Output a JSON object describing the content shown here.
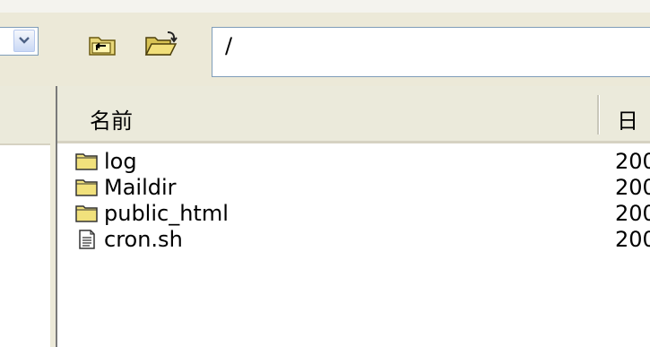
{
  "left_panel": {
    "dropdown_icon": "chevron-down-icon"
  },
  "toolbar": {
    "up_icon": "folder-up-icon",
    "open_icon": "open-folder-icon",
    "path_value": "/"
  },
  "file_list": {
    "columns": {
      "name": "名前",
      "date": "日"
    },
    "rows": [
      {
        "name": "log",
        "type": "folder",
        "date": "200"
      },
      {
        "name": "Maildir",
        "type": "folder",
        "date": "200"
      },
      {
        "name": "public_html",
        "type": "folder",
        "date": "200"
      },
      {
        "name": "cron.sh",
        "type": "file",
        "date": "200"
      }
    ]
  }
}
